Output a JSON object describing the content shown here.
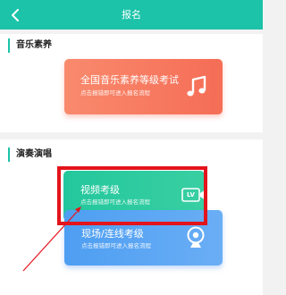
{
  "header": {
    "title": "报名",
    "back_icon": "chevron-left-icon"
  },
  "sections": [
    {
      "title": "音乐素养",
      "cards": [
        {
          "title": "全国音乐素养等级考试",
          "subtitle": "点击报错即可进入报名流程",
          "icon": "music-note-icon"
        }
      ]
    },
    {
      "title": "演奏演唱",
      "cards": [
        {
          "title": "视频考级",
          "subtitle": "点击报错即可进入报名流程",
          "icon": "video-camera-icon",
          "icon_badge": "LV"
        },
        {
          "title": "现场/连线考级",
          "subtitle": "点击报错即可进入报名流程",
          "icon": "webcam-icon"
        }
      ]
    }
  ],
  "colors": {
    "header": "#1cc3a9",
    "music_card": "#f67a60",
    "video_card": "#2dcb9f",
    "live_card": "#5aa5f3",
    "highlight": "#e3141b"
  }
}
